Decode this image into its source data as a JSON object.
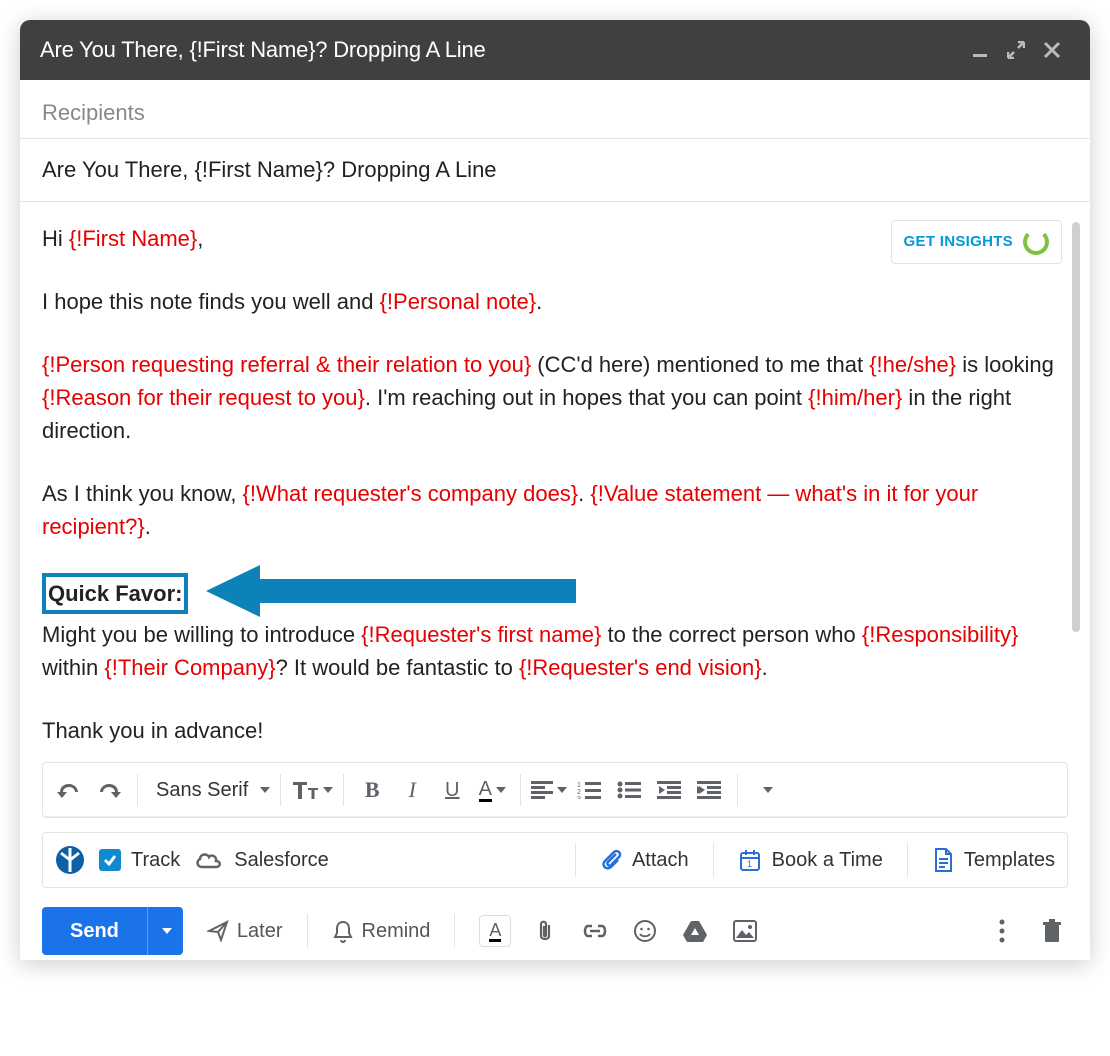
{
  "window": {
    "title": "Are You There, {!First Name}? Dropping A Line"
  },
  "recipients": {
    "placeholder": "Recipients"
  },
  "subject": "Are You There, {!First Name}? Dropping A Line",
  "body": {
    "greet_pre": "Hi ",
    "greet_mf": "{!First Name}",
    "greet_post": ",",
    "p1_pre": "I hope this note finds you well and ",
    "p1_mf": "{!Personal note}",
    "p1_post": ".",
    "p2_mf1": "{!Person requesting referral & their relation to you}",
    "p2_t1": " (CC'd here) mentioned to me that ",
    "p2_mf2": "{!he/she}",
    "p2_t2": " is looking ",
    "p2_mf3": "{!Reason for their request to you}",
    "p2_t3": ". I'm reaching out in hopes that you can point ",
    "p2_mf4": "{!him/her}",
    "p2_t4": " in the right direction.",
    "p3_t1": "As I think you know, ",
    "p3_mf1": "{!What requester's company does}",
    "p3_t2": ". ",
    "p3_mf2": "{!Value statement — what's in it for your recipient?}",
    "p3_t3": ".",
    "favor_label": "Quick Favor:",
    "p4_t1": "Might you be willing to introduce ",
    "p4_mf1": "{!Requester's first name}",
    "p4_t2": " to the correct person who ",
    "p4_mf2": "{!Responsibility}",
    "p4_t3": " within ",
    "p4_mf3": "{!Their Company}",
    "p4_t4": "? It would be fantastic to ",
    "p4_mf4": "{!Requester's end vision}",
    "p4_t5": ".",
    "thanks": "Thank you in advance!"
  },
  "insights": {
    "label": "GET INSIGHTS"
  },
  "toolbar": {
    "font": "Sans Serif",
    "bold": "B",
    "italic": "I",
    "underline": "U",
    "textcolor": "A"
  },
  "plugin": {
    "track": "Track",
    "salesforce": "Salesforce",
    "attach": "Attach",
    "book": "Book a Time",
    "templates": "Templates"
  },
  "send": {
    "label": "Send",
    "later": "Later",
    "remind": "Remind",
    "textcolor": "A"
  },
  "colors": {
    "merge_field": "#e60000",
    "accent": "#0d82b8",
    "send": "#1a73e8"
  }
}
